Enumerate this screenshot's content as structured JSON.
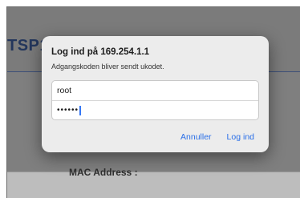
{
  "background": {
    "page_title": "TSP1",
    "section_label": "MAC Address :"
  },
  "dialog": {
    "title": "Log ind på 169.254.1.1",
    "message": "Adgangskoden bliver sendt ukodet.",
    "username_value": "root",
    "password_value": "••••••",
    "cancel_label": "Annuller",
    "login_label": "Log ind"
  },
  "colors": {
    "accent": "#2a6fe8",
    "caret": "#3477f6",
    "dialog_bg": "#ececec",
    "header_text": "#23365c"
  }
}
